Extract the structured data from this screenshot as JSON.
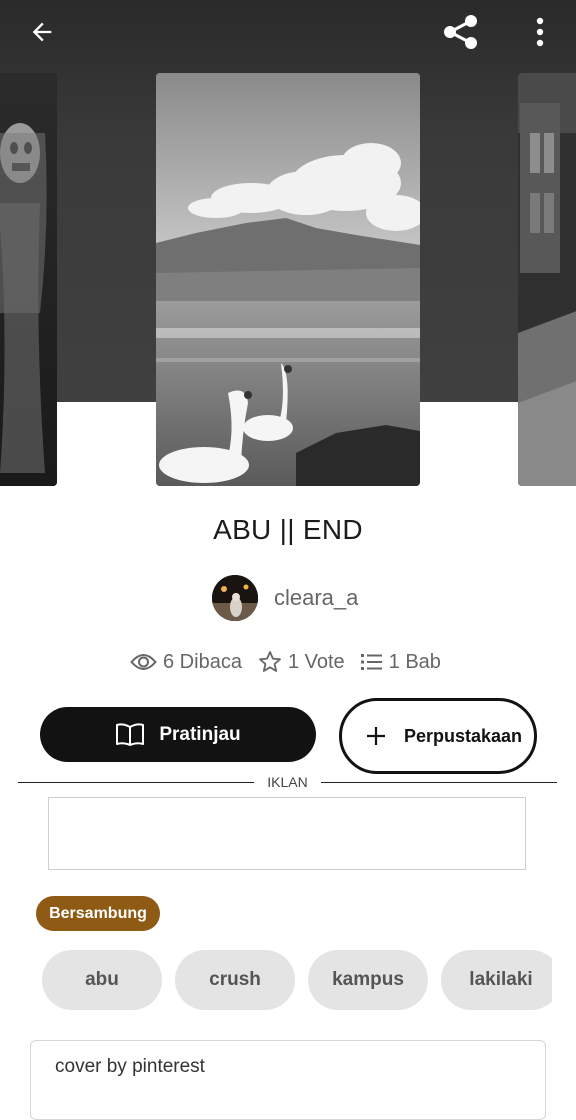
{
  "header": {
    "back_icon": "arrow-left-icon",
    "share_icon": "share-icon",
    "more_icon": "more-vertical-icon"
  },
  "story": {
    "title": "ABU || END",
    "author": "cleara_a",
    "stats": {
      "reads": "6 Dibaca",
      "votes": "1 Vote",
      "parts": "1 Bab"
    }
  },
  "actions": {
    "preview_label": "Pratinjau",
    "library_label": "Perpustakaan"
  },
  "ad": {
    "label": "IKLAN"
  },
  "status": {
    "label": "Bersambung",
    "color": "#8e5a14"
  },
  "tags": [
    "abu",
    "crush",
    "kampus",
    "lakilaki"
  ],
  "description": "cover by pinterest"
}
